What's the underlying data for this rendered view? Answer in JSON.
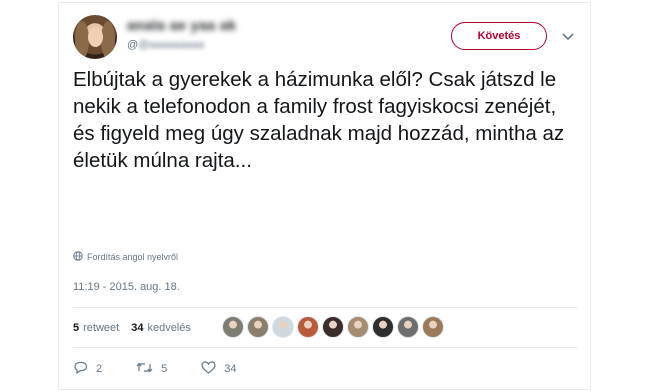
{
  "user": {
    "name_blurred": "anala ae yaa ak",
    "handle_blurred": "@aaaaaaaaa",
    "handle_prefix": "@"
  },
  "follow_label": "Követés",
  "tweet_text": "Elbújtak a gyerekek a házimunka elől? Csak játszd le nekik a telefonodon a family frost fagyiskocsi zenéjét, és figyeld meg úgy szaladnak majd hozzád, mintha az életük múlna rajta...",
  "translate_label": "Fordítás angol nyelvről",
  "timestamp": "11:19 - 2015. aug. 18.",
  "stats": {
    "retweet_count": "5",
    "retweet_label": "retweet",
    "like_count": "34",
    "like_label": "kedvelés"
  },
  "likers": [
    {
      "icon": "avatar-landscape",
      "color": "#7d7d72"
    },
    {
      "icon": "avatar-group",
      "color": "#8a7f6e"
    },
    {
      "icon": "avatar-default",
      "color": "#cfd8de"
    },
    {
      "icon": "avatar-hat",
      "color": "#b85a3c"
    },
    {
      "icon": "avatar-dark",
      "color": "#3b2e2a"
    },
    {
      "icon": "avatar-woman",
      "color": "#a58c73"
    },
    {
      "icon": "avatar-dog",
      "color": "#2e2e2e"
    },
    {
      "icon": "avatar-bw",
      "color": "#6e6e6e"
    },
    {
      "icon": "avatar-man",
      "color": "#9b7a5a"
    }
  ],
  "actions": {
    "reply_count": "2",
    "retweet_count": "5",
    "like_count": "34"
  },
  "colors": {
    "accent": "#b8002e",
    "muted": "#657786",
    "text": "#14171a",
    "border": "#e6ecf0"
  }
}
